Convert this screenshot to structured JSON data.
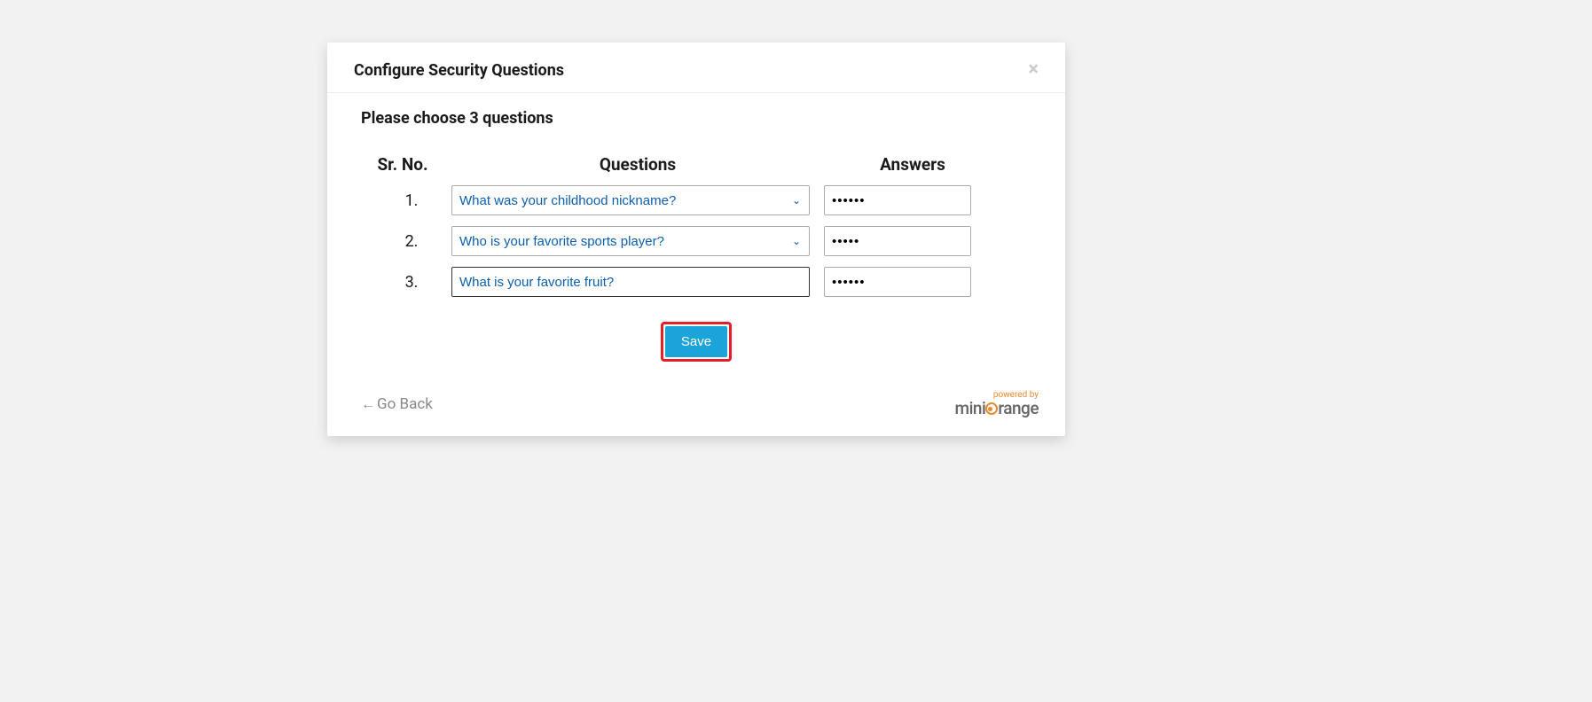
{
  "modal": {
    "title": "Configure Security Questions",
    "instruction": "Please choose 3 questions",
    "headers": {
      "srno": "Sr. No.",
      "questions": "Questions",
      "answers": "Answers"
    },
    "rows": [
      {
        "number": "1.",
        "question": "What was your childhood nickname?",
        "answer": "••••••",
        "type": "select"
      },
      {
        "number": "2.",
        "question": "Who is your favorite sports player?",
        "answer": "•••••",
        "type": "select"
      },
      {
        "number": "3.",
        "question": "What is your favorite fruit?",
        "answer": "••••••",
        "type": "text"
      }
    ],
    "save_label": "Save",
    "go_back_label": "Go Back"
  },
  "branding": {
    "powered_by": "powered by",
    "name_prefix": "mini",
    "name_suffix": "range"
  }
}
